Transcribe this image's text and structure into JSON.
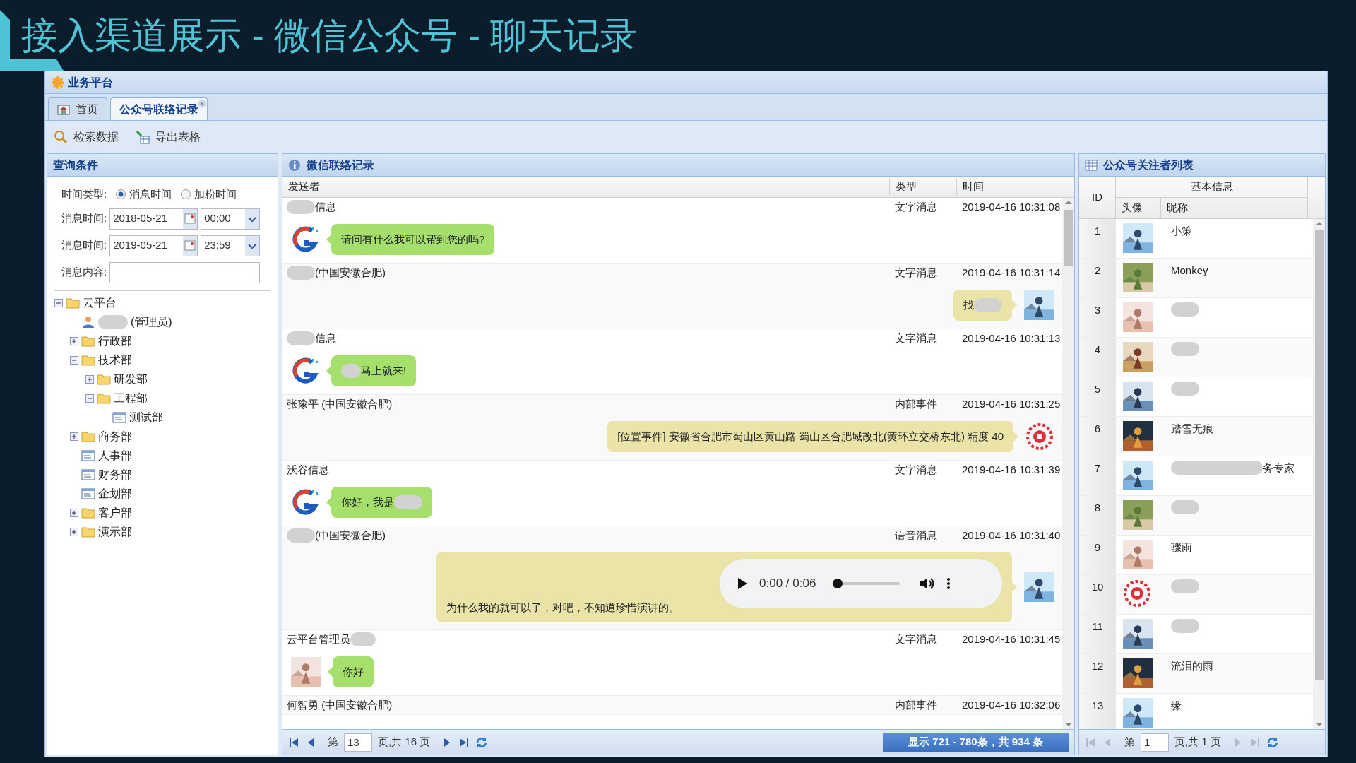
{
  "page_title": "接入渠道展示 - 微信公众号 - 聊天记录",
  "app": {
    "title": "业务平台"
  },
  "tabs": [
    {
      "label": "首页",
      "selected": false,
      "closable": false
    },
    {
      "label": "公众号联络记录",
      "selected": true,
      "closable": true
    }
  ],
  "toolbar": [
    {
      "label": "检索数据",
      "kind": "search"
    },
    {
      "label": "导出表格",
      "kind": "export"
    }
  ],
  "query": {
    "title": "查询条件",
    "time_type": {
      "label": "时间类型:",
      "options": [
        {
          "label": "消息时间",
          "selected": true
        },
        {
          "label": "加粉时间",
          "selected": false
        }
      ]
    },
    "ranges": [
      {
        "label": "消息时间:",
        "date": "2018-05-21",
        "time": "00:00"
      },
      {
        "label": "消息时间:",
        "date": "2019-05-21",
        "time": "23:59"
      }
    ],
    "content": {
      "label": "消息内容:"
    }
  },
  "tree": [
    {
      "label": "云平台",
      "kind": "folder",
      "expanded": true,
      "children": [
        {
          "label": "(管理员)",
          "kind": "user",
          "redacted": true
        },
        {
          "label": "行政部",
          "kind": "folder",
          "expanded": false
        },
        {
          "label": "技术部",
          "kind": "folder",
          "expanded": true,
          "children": [
            {
              "label": "研发部",
              "kind": "folder",
              "expanded": false
            },
            {
              "label": "工程部",
              "kind": "folder",
              "expanded": true,
              "children": [
                {
                  "label": "测试部",
                  "kind": "leaf"
                }
              ]
            }
          ]
        },
        {
          "label": "商务部",
          "kind": "folder",
          "expanded": false
        },
        {
          "label": "人事部",
          "kind": "leaf"
        },
        {
          "label": "财务部",
          "kind": "leaf"
        },
        {
          "label": "企划部",
          "kind": "leaf"
        },
        {
          "label": "客户部",
          "kind": "folder",
          "expanded": false
        },
        {
          "label": "演示部",
          "kind": "folder",
          "expanded": false
        }
      ]
    }
  ],
  "chat": {
    "title": "微信联络记录",
    "columns": [
      "发送者",
      "类型",
      "时间"
    ],
    "messages": [
      {
        "sender": "信息",
        "sender_redacted_before": true,
        "type": "文字消息",
        "time": "2019-04-16 10:31:08",
        "incoming": false,
        "kind": "text",
        "avatar": {
          "kind": "logo"
        },
        "text": "请问有什么我可以帮到您的吗?"
      },
      {
        "sender": "(中国安徽合肥)",
        "sender_redacted_before": true,
        "type": "文字消息",
        "time": "2019-04-16 10:31:14",
        "incoming": true,
        "kind": "text",
        "text": "找",
        "text_redacted_after": true
      },
      {
        "sender": "信息",
        "sender_redacted_before": true,
        "type": "文字消息",
        "time": "2019-04-16 10:31:13",
        "incoming": false,
        "kind": "text",
        "avatar": {
          "kind": "logo"
        },
        "text": "马上就来!",
        "text_redacted_before": true
      },
      {
        "sender": "张豫平 (中国安徽合肥)",
        "type": "内部事件",
        "time": "2019-04-16 10:31:25",
        "incoming": true,
        "kind": "text",
        "avatar": {
          "kind": "pattern"
        },
        "text": "[位置事件] 安徽省合肥市蜀山区黄山路 蜀山区合肥城改北(黄环立交桥东北) 精度 40"
      },
      {
        "sender": "沃谷信息",
        "type": "文字消息",
        "time": "2019-04-16 10:31:39",
        "incoming": false,
        "kind": "text",
        "avatar": {
          "kind": "logo"
        },
        "text": "你好，我是",
        "text_redacted_after": true
      },
      {
        "sender": "(中国安徽合肥)",
        "sender_redacted_before": true,
        "type": "语音消息",
        "time": "2019-04-16 10:31:40",
        "incoming": true,
        "kind": "voice",
        "text": "为什么我的就可以了，对吧，不知道珍惜演讲的。",
        "player": {
          "time": "0:00 / 0:06",
          "level": 0
        }
      },
      {
        "sender": "云平台管理员",
        "sender_redacted_after": true,
        "type": "文字消息",
        "time": "2019-04-16 10:31:45",
        "incoming": false,
        "kind": "text",
        "text": "你好"
      },
      {
        "sender": "何智勇 (中国安徽合肥)",
        "type": "内部事件",
        "time": "2019-04-16 10:32:06",
        "kind": "header_only"
      }
    ],
    "pager": {
      "page_label": "第",
      "page": "13",
      "total": "页,共 16 页",
      "summary": "显示 721 - 780条，共 934 条"
    }
  },
  "followers": {
    "title": "公众号关注者列表",
    "columns": {
      "id": "ID",
      "group": "基本信息",
      "avatar": "头像",
      "nickname": "昵称"
    },
    "rows": [
      {
        "id": "1",
        "nickname": "小策",
        "redacted": false
      },
      {
        "id": "2",
        "nickname": "Monkey",
        "redacted": false
      },
      {
        "id": "3",
        "redacted": true
      },
      {
        "id": "4",
        "redacted": true
      },
      {
        "id": "5",
        "redacted": true
      },
      {
        "id": "6",
        "nickname": "踏雪无痕",
        "redacted": false
      },
      {
        "id": "7",
        "nickname": "务专家",
        "redacted": true
      },
      {
        "id": "8",
        "redacted": true
      },
      {
        "id": "9",
        "nickname": "骤雨",
        "redacted": false
      },
      {
        "id": "10",
        "redacted": true
      },
      {
        "id": "11",
        "redacted": true
      },
      {
        "id": "12",
        "nickname": "流泪的雨",
        "redacted": false
      },
      {
        "id": "13",
        "nickname": "缘",
        "redacted": false
      }
    ],
    "pager": {
      "page_label": "第",
      "page": "1",
      "total": "页,共 1 页"
    }
  }
}
